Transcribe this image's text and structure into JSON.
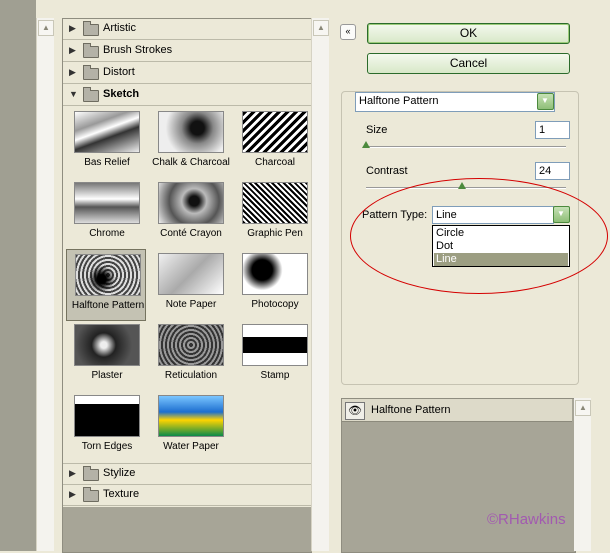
{
  "buttons": {
    "ok": "OK",
    "cancel": "Cancel",
    "collapse": "«"
  },
  "categories_top": [
    {
      "label": "Artistic",
      "expanded": false
    },
    {
      "label": "Brush Strokes",
      "expanded": false
    },
    {
      "label": "Distort",
      "expanded": false
    },
    {
      "label": "Sketch",
      "expanded": true
    }
  ],
  "categories_bottom": [
    {
      "label": "Stylize",
      "expanded": false
    },
    {
      "label": "Texture",
      "expanded": false
    }
  ],
  "sketch_filters": [
    "Bas Relief",
    "Chalk & Charcoal",
    "Charcoal",
    "Chrome",
    "Conté Crayon",
    "Graphic Pen",
    "Halftone Pattern",
    "Note Paper",
    "Photocopy",
    "Plaster",
    "Reticulation",
    "Stamp",
    "Torn Edges",
    "Water Paper"
  ],
  "selected_filter": "Halftone Pattern",
  "settings": {
    "filter_select": "Halftone Pattern",
    "size_label": "Size",
    "size_value": "1",
    "size_fraction": 0.0,
    "contrast_label": "Contrast",
    "contrast_value": "24",
    "contrast_fraction": 0.48,
    "pattern_type_label": "Pattern Type:",
    "pattern_type_value": "Line",
    "pattern_options": [
      "Circle",
      "Dot",
      "Line"
    ],
    "pattern_selected": "Line"
  },
  "layers": {
    "name": "Halftone Pattern"
  },
  "credit": "©RHawkins",
  "colors": {
    "annotation_circle": "#d40000",
    "credit": "#a25ab0",
    "selected_option": "#9c9e82"
  }
}
